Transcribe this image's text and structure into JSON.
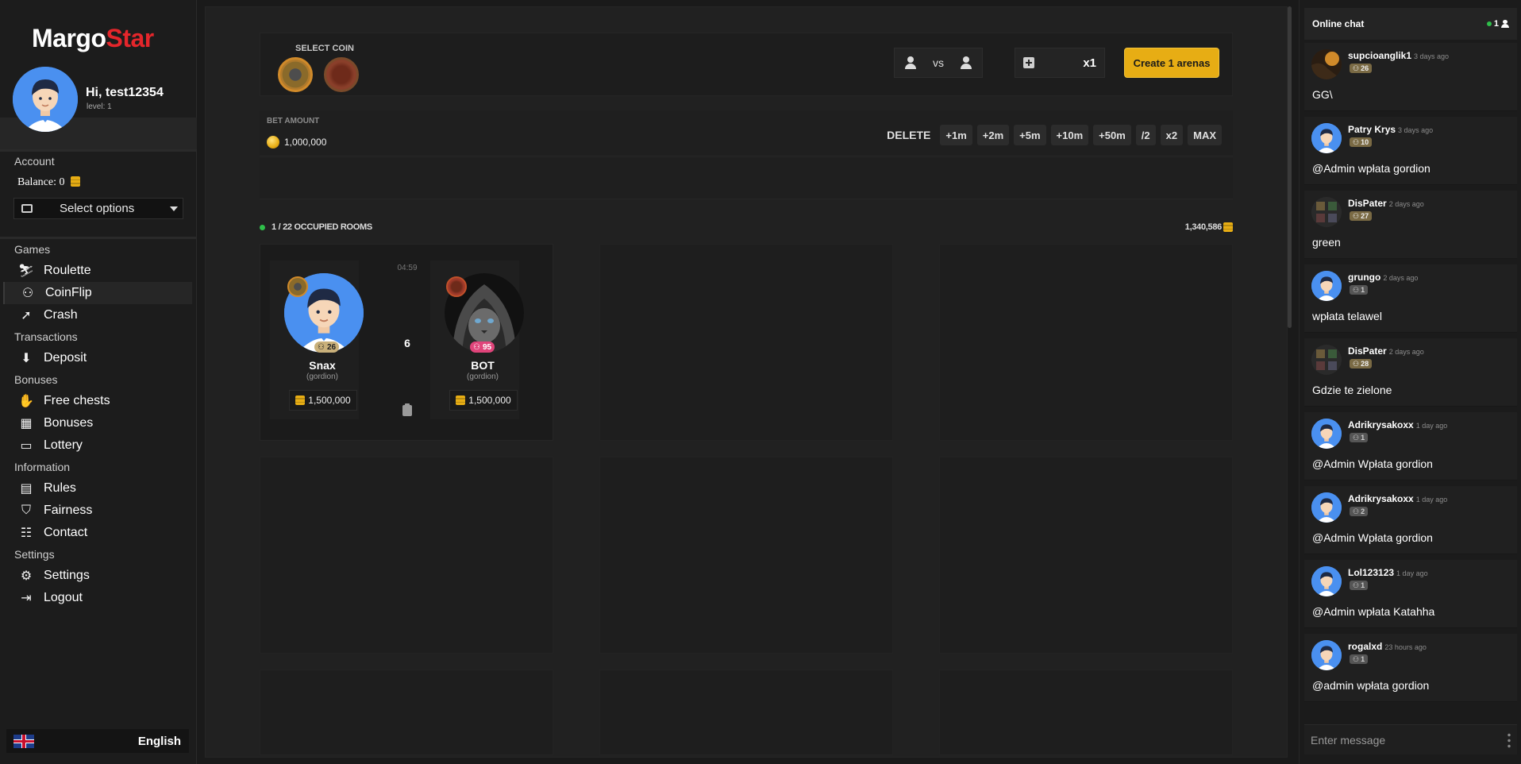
{
  "sidebar": {
    "logo_part1": "Margo",
    "logo_part2": "Star",
    "greeting": "Hi, test12354",
    "level": "level: 1",
    "account_heading": "Account",
    "balance": "Balance: 0",
    "select_placeholder": "Select options",
    "sections": {
      "games": "Games",
      "transactions": "Transactions",
      "bonuses": "Bonuses",
      "information": "Information",
      "settings": "Settings"
    },
    "items": {
      "roulette": "Roulette",
      "coinflip": "CoinFlip",
      "crash": "Crash",
      "deposit": "Deposit",
      "free_chests": "Free chests",
      "bonuses": "Bonuses",
      "lottery": "Lottery",
      "rules": "Rules",
      "fairness": "Fairness",
      "contact": "Contact",
      "settings": "Settings",
      "logout": "Logout"
    },
    "active_item": "coinflip",
    "language": "English"
  },
  "main": {
    "select_coin_label": "SELECT COIN",
    "vs_label": "vs",
    "multiplier": "x1",
    "create_button": "Create 1 arenas",
    "bet_amount_label": "BET AMOUNT",
    "bet_amount": "1,000,000",
    "delete_label": "DELETE",
    "bet_buttons": [
      "+1m",
      "+2m",
      "+5m",
      "+10m",
      "+50m",
      "/2",
      "x2",
      "MAX"
    ],
    "rooms_status": "1 / 22  OCCUPIED ROOMS",
    "rooms_total": "1,340,586",
    "room": {
      "timer": "04:59",
      "center_number": "6",
      "player1": {
        "name": "Snax",
        "sub": "(gordion)",
        "level": "26",
        "bet": "1,500,000"
      },
      "player2": {
        "name": "BOT",
        "sub": "(gordion)",
        "level": "95",
        "bet": "1,500,000"
      }
    }
  },
  "chat": {
    "title": "Online chat",
    "online_count": "1",
    "input_placeholder": "Enter message",
    "messages": [
      {
        "user": "supcioanglik1",
        "time": "3 days ago",
        "level": "26",
        "text": "GG\\"
      },
      {
        "user": "Patry Krys",
        "time": "3 days ago",
        "level": "10",
        "text": "@Admin wpłata gordion"
      },
      {
        "user": "DisPater",
        "time": "2 days ago",
        "level": "27",
        "text": "green"
      },
      {
        "user": "grungo",
        "time": "2 days ago",
        "level": "1",
        "text": "wpłata telawel"
      },
      {
        "user": "DisPater",
        "time": "2 days ago",
        "level": "28",
        "text": "Gdzie te zielone"
      },
      {
        "user": "Adrikrysakoxx",
        "time": "1 day ago",
        "level": "1",
        "text": "@Admin Wpłata gordion"
      },
      {
        "user": "Adrikrysakoxx",
        "time": "1 day ago",
        "level": "2",
        "text": "@Admin Wpłata gordion"
      },
      {
        "user": "Lol123123",
        "time": "1 day ago",
        "level": "1",
        "text": "@Admin wpłata Katahha"
      },
      {
        "user": "rogalxd",
        "time": "23 hours ago",
        "level": "1",
        "text": "@admin wpłata gordion"
      }
    ]
  },
  "colors": {
    "accent_yellow": "#e7ad14",
    "brand_red": "#e4262b",
    "online_green": "#2fbf4a",
    "avatar_blue": "#4a90f0"
  }
}
